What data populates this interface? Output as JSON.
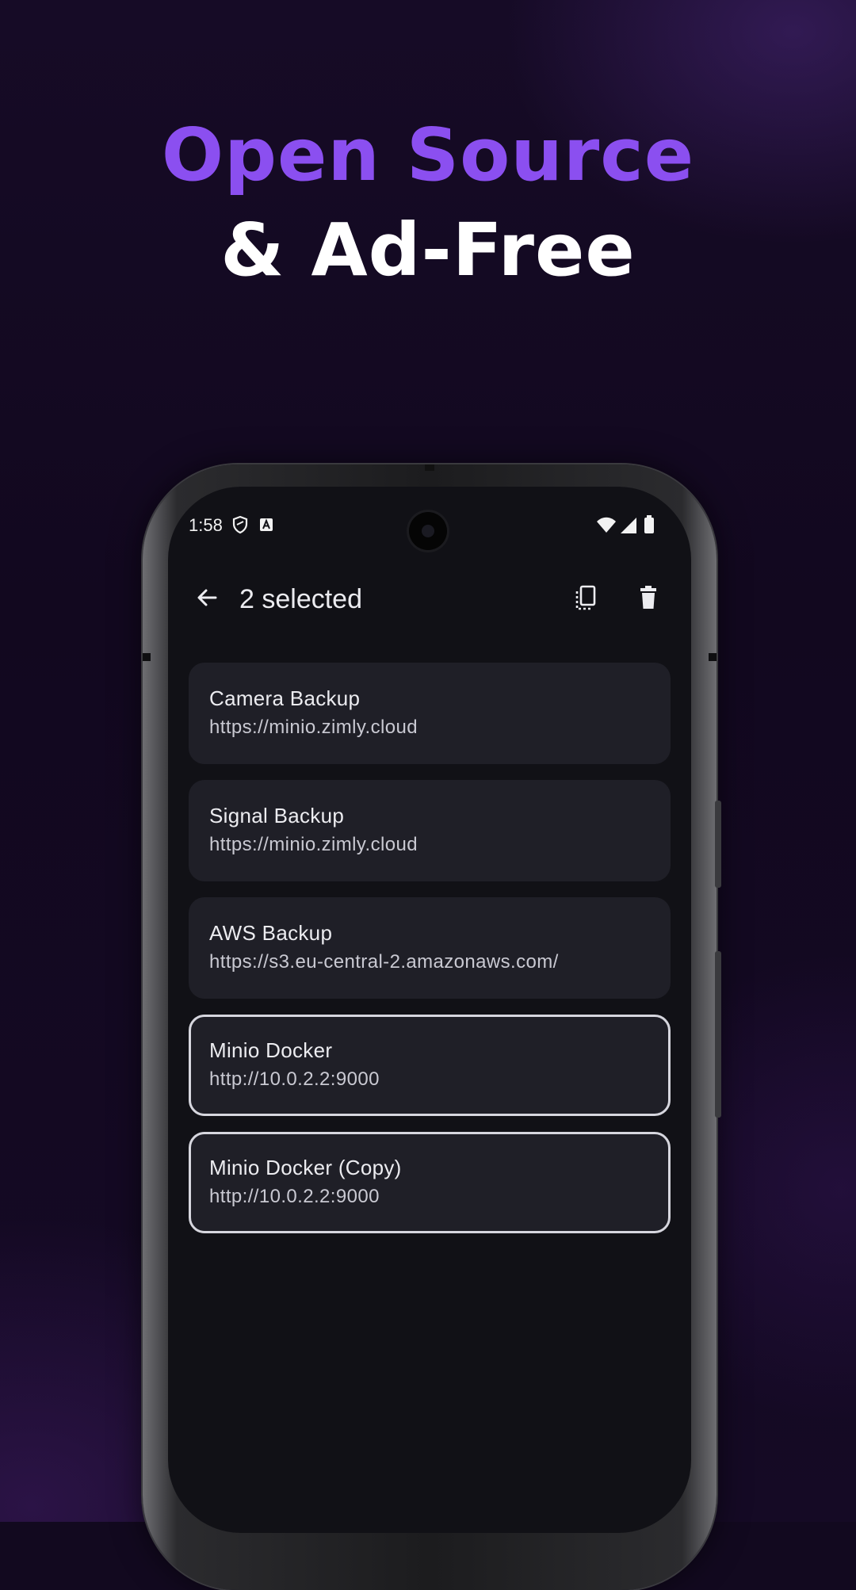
{
  "promo": {
    "line1": "Open Source",
    "line2": "& Ad-Free"
  },
  "status_bar": {
    "time": "1:58",
    "icons": [
      "shield-icon",
      "a-badge-icon",
      "wifi-icon",
      "signal-icon",
      "battery-icon"
    ]
  },
  "app_bar": {
    "title": "2 selected",
    "icons": [
      "back-arrow-icon",
      "copy-icon",
      "trash-icon"
    ]
  },
  "connections": [
    {
      "name": "Camera Backup",
      "url": "https://minio.zimly.cloud",
      "selected": false
    },
    {
      "name": "Signal Backup",
      "url": "https://minio.zimly.cloud",
      "selected": false
    },
    {
      "name": "AWS Backup",
      "url": "https://s3.eu-central-2.amazonaws.com/",
      "selected": false
    },
    {
      "name": "Minio Docker",
      "url": "http://10.0.2.2:9000",
      "selected": true
    },
    {
      "name": "Minio Docker (Copy)",
      "url": "http://10.0.2.2:9000",
      "selected": true
    }
  ],
  "colors": {
    "accent": "#8b4ff0",
    "background": "#12091f",
    "screen": "#111116",
    "card": "#1f1f27",
    "selected_border": "#d6d6de"
  }
}
